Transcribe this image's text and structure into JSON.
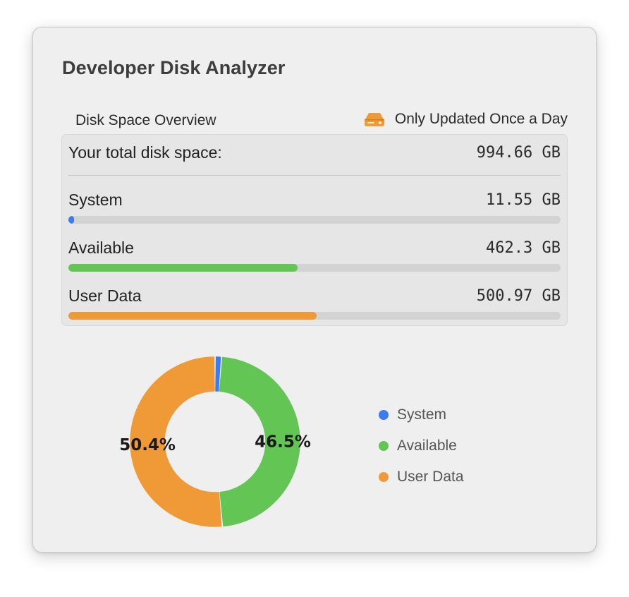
{
  "window": {
    "title": "Developer Disk Analyzer"
  },
  "overview": {
    "header": "Disk Space Overview",
    "update_note": "Only Updated Once a Day",
    "update_icon": "hard-drive-icon",
    "total_label": "Your total disk space:",
    "total_value": "994.66 GB",
    "items": [
      {
        "label": "System",
        "value": "11.55 GB",
        "fraction": 0.0116,
        "color": "#3b7bf5"
      },
      {
        "label": "Available",
        "value": "462.3 GB",
        "fraction": 0.465,
        "color": "#62c554"
      },
      {
        "label": "User Data",
        "value": "500.97 GB",
        "fraction": 0.504,
        "color": "#f09a37"
      }
    ]
  },
  "chart_data": {
    "type": "pie",
    "categories": [
      "System",
      "Available",
      "User Data"
    ],
    "values": [
      1.2,
      46.5,
      50.4
    ],
    "data_labels": [
      "",
      "46.5%",
      "50.4%"
    ],
    "colors": [
      "#3b7bf5",
      "#62c554",
      "#f09a37"
    ],
    "donut": true,
    "legend": "right"
  }
}
